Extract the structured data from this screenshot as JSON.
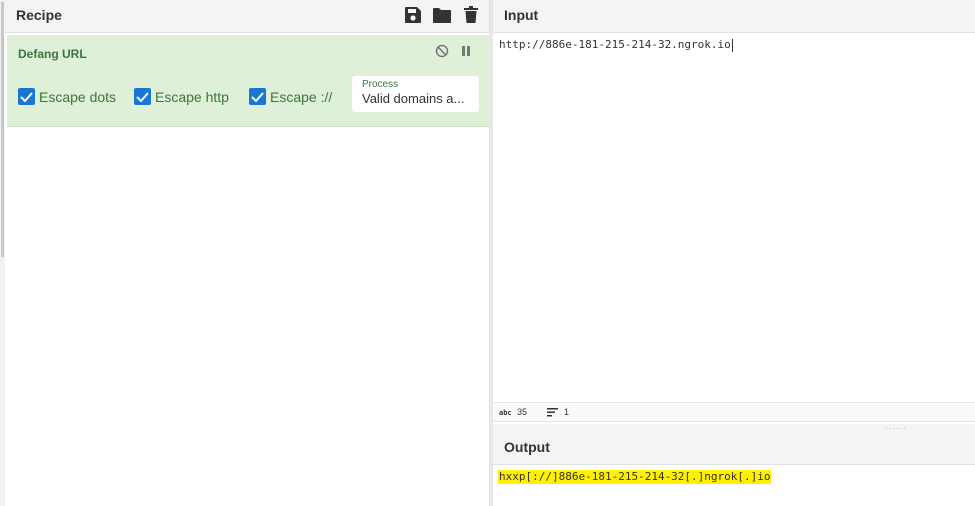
{
  "recipe": {
    "title": "Recipe",
    "icons": [
      "save-icon",
      "folder-icon",
      "trash-icon"
    ],
    "operation": {
      "title": "Defang URL",
      "checkboxes": [
        {
          "label": "Escape dots",
          "checked": true
        },
        {
          "label": "Escape http",
          "checked": true
        },
        {
          "label": "Escape ://",
          "checked": true
        }
      ],
      "process": {
        "label": "Process",
        "value": "Valid domains a..."
      },
      "controls": [
        "disable-icon",
        "pause-icon"
      ]
    }
  },
  "input": {
    "title": "Input",
    "text": "http://886e-181-215-214-32.ngrok.io",
    "status": {
      "chars": "35",
      "lines": "1"
    }
  },
  "output": {
    "title": "Output",
    "text": "hxxp[://]886e-181-215-214-32[.]ngrok[.]io"
  },
  "colors": {
    "op_background": "#dff0d8",
    "op_text": "#3c763d",
    "checkbox": "#1976d2",
    "highlight": "#fff000"
  }
}
